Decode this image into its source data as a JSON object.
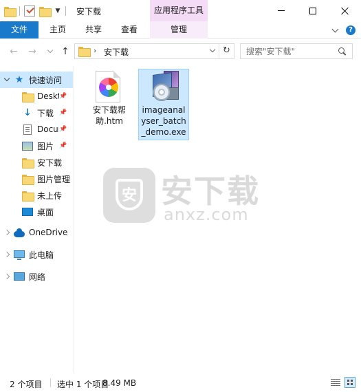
{
  "window": {
    "title": "安下载",
    "tool_tab_header": "应用程序工具"
  },
  "ribbon": {
    "tabs": [
      "文件",
      "主页",
      "共享",
      "查看",
      "管理"
    ]
  },
  "address": {
    "path": "安下载",
    "search_placeholder": "搜索\"安下载\""
  },
  "navpane": {
    "quick_access": "快速访问",
    "items": [
      {
        "label": "Deskt",
        "icon": "folder-icon",
        "pinned": true
      },
      {
        "label": "下载",
        "icon": "download-arrow-icon",
        "pinned": true
      },
      {
        "label": "Docur",
        "icon": "document-icon",
        "pinned": true
      },
      {
        "label": "图片",
        "icon": "pictures-icon",
        "pinned": true
      },
      {
        "label": "安下载",
        "icon": "folder-icon",
        "pinned": false
      },
      {
        "label": "图片管理",
        "icon": "folder-icon",
        "pinned": false
      },
      {
        "label": "未上传",
        "icon": "folder-icon",
        "pinned": false
      },
      {
        "label": "桌面",
        "icon": "desktop-icon",
        "pinned": false
      }
    ],
    "onedrive": "OneDrive",
    "this_pc": "此电脑",
    "network": "网络"
  },
  "files": [
    {
      "name_lines": [
        "安下载帮",
        "助.htm"
      ],
      "icon": "htm-file-icon",
      "selected": false
    },
    {
      "name_lines": [
        "imageanal",
        "yser_batch",
        "_demo.exe"
      ],
      "icon": "installer-exe-icon",
      "selected": true
    }
  ],
  "watermark": {
    "badge": "安",
    "title": "安下载",
    "domain": "anxz.com"
  },
  "status": {
    "count": "2 个项目",
    "selected": "选中 1 个项目",
    "size": "8.49 MB"
  },
  "colors": {
    "accent": "#1979ca",
    "selection": "#cce8ff",
    "tool_tab": "#f4dbf6"
  }
}
